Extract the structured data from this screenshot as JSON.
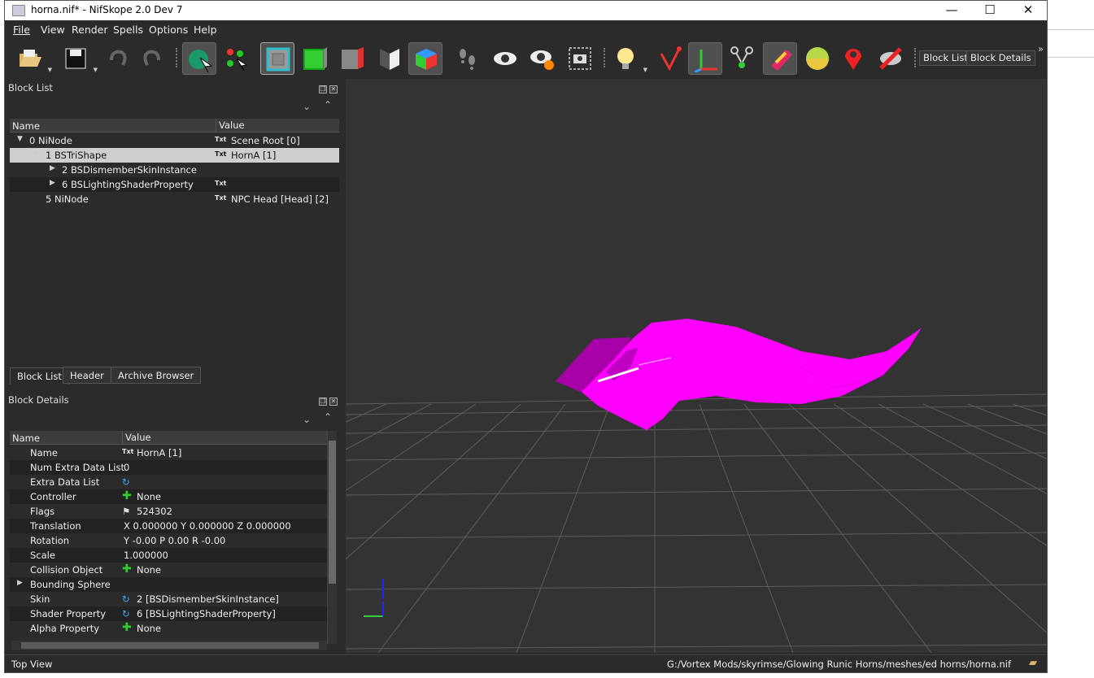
{
  "window": {
    "title": "horna.nif* - NifSkope 2.0 Dev 7",
    "minimize": "—",
    "maximize": "☐",
    "close": "✕"
  },
  "menu": [
    "File",
    "View",
    "Render",
    "Spells",
    "Options",
    "Help"
  ],
  "toolbar": {
    "icons": [
      "open-file-icon",
      "save-icon",
      "undo-icon",
      "redo-icon",
      "select-object-icon",
      "select-vertex-icon",
      "view-top-icon",
      "view-front-icon",
      "view-side-icon",
      "view-user-icon",
      "view-perspective-icon",
      "walk-mode-icon",
      "show-hidden-icon",
      "show-nodes-icon",
      "screenshot-icon",
      "lighting-icon",
      "axes-icon",
      "show-constraints-icon",
      "show-havok-icon",
      "textures-icon",
      "vertex-colors-icon",
      "marker-icon",
      "hide-icon"
    ],
    "block_list_label": "Block List",
    "block_details_label": "Block Details",
    "overflow": "»"
  },
  "block_list": {
    "title": "Block List",
    "columns": [
      "Name",
      "Value"
    ],
    "rows": [
      {
        "name": "0 NiNode",
        "value": "Scene Root [0]",
        "expander": "▼"
      },
      {
        "name": "1 BSTriShape",
        "value": "HornA [1]",
        "expander": "▼"
      },
      {
        "name": "2 BSDismemberSkinInstance",
        "value": "",
        "expander": "▶"
      },
      {
        "name": "6 BSLightingShaderProperty",
        "value": "",
        "expander": "▶"
      },
      {
        "name": "5 NiNode",
        "value": "NPC Head [Head] [2]",
        "expander": ""
      }
    ],
    "txt_badge": "Txt",
    "tabs": [
      "Block List",
      "Header",
      "Archive Browser"
    ]
  },
  "block_details": {
    "title": "Block Details",
    "columns": [
      "Name",
      "Value"
    ],
    "rows": [
      {
        "name": "Name",
        "value": "HornA [1]"
      },
      {
        "name": "Num Extra Data List",
        "value": "0"
      },
      {
        "name": "Extra Data List",
        "value": ""
      },
      {
        "name": "Controller",
        "value": "None"
      },
      {
        "name": "Flags",
        "value": "524302"
      },
      {
        "name": "Translation",
        "value": "X 0.000000 Y 0.000000 Z 0.000000"
      },
      {
        "name": "Rotation",
        "value": "Y -0.00 P 0.00 R -0.00"
      },
      {
        "name": "Scale",
        "value": "1.000000"
      },
      {
        "name": "Collision Object",
        "value": "None"
      },
      {
        "name": "Bounding Sphere",
        "value": ""
      },
      {
        "name": "Skin",
        "value": "2 [BSDismemberSkinInstance]"
      },
      {
        "name": "Shader Property",
        "value": "6 [BSLightingShaderProperty]"
      },
      {
        "name": "Alpha Property",
        "value": "None"
      }
    ],
    "bounding_expander": "▶"
  },
  "status": {
    "view": "Top View",
    "path": "G:/Vortex Mods/skyrimse/Glowing Runic Horns/meshes/ed horns/horna.nif"
  },
  "colors": {
    "mesh": "#ff00ff",
    "bg": "#2b2b2b",
    "viewport": "#333333"
  }
}
